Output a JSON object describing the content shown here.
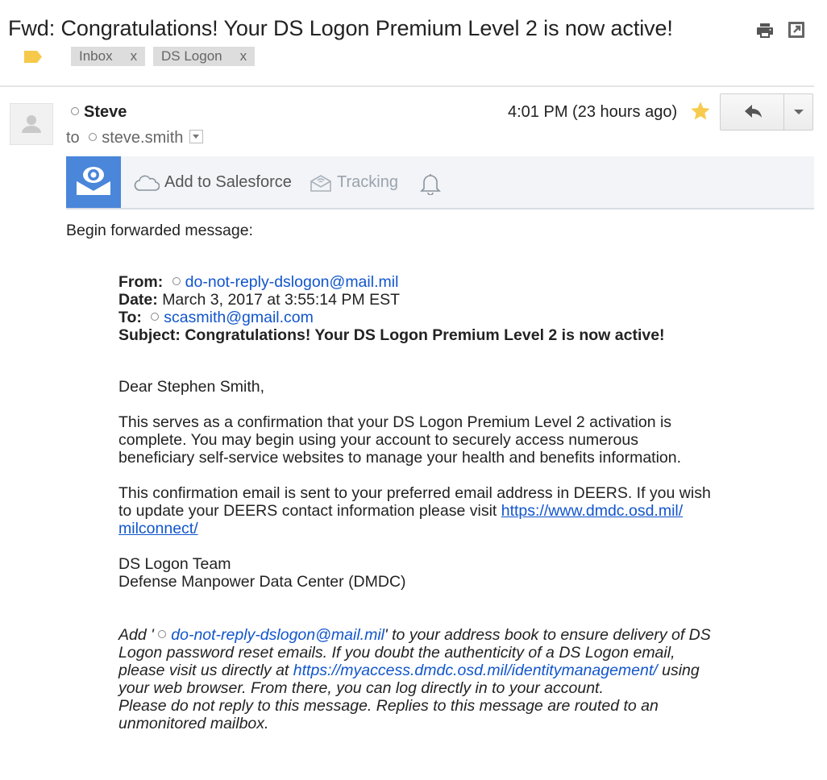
{
  "email": {
    "subject": "Fwd: Congratulations! Your DS Logon Premium Level 2 is now active!",
    "labels": [
      {
        "name": "Inbox",
        "remove": "x"
      },
      {
        "name": "DS Logon",
        "remove": "x"
      }
    ],
    "sender": {
      "name": "Steve"
    },
    "to_prefix": "to",
    "recipient": "steve.smith",
    "time": "4:01 PM (23 hours ago)",
    "starred": true
  },
  "salesforce_bar": {
    "add_label": "Add to Salesforce",
    "tracking_label": "Tracking"
  },
  "body": {
    "intro": "Begin forwarded message:",
    "forward_header": {
      "from_label": "From:",
      "from_value": "do-not-reply-dslogon@mail.mil",
      "date_label": "Date:",
      "date_value": "March 3, 2017 at 3:55:14 PM EST",
      "to_label": "To:",
      "to_value": "scasmith@gmail.com",
      "subject_line": "Subject: Congratulations! Your DS Logon Premium Level 2 is now active!"
    },
    "greeting": "Dear Stephen Smith,",
    "para1": [
      "This serves as a confirmation that your DS Logon Premium Level 2 activation is",
      "complete. You may begin using your account to securely access numerous",
      "beneficiary self-service websites to manage your health and benefits information."
    ],
    "para2_line1": "This confirmation email is sent to your preferred email address in DEERS. If you wish",
    "para2_line2_text": "to update your DEERS contact information please visit ",
    "para2_link_part1": "https://www.dmdc.osd.mil/",
    "para2_link_part2": "milconnect/",
    "signature": [
      "DS Logon Team",
      "Defense Manpower Data Center (DMDC)"
    ],
    "footer": {
      "line1_pre": "Add '",
      "line1_link": "do-not-reply-dslogon@mail.mil",
      "line1_post": "' to your address book to ensure delivery of DS",
      "line2": "Logon password reset emails. If you doubt the authenticity of a DS Logon email,",
      "line3_pre": "please visit us directly at ",
      "line3_link": "https://myaccess.dmdc.osd.mil/identitymanagement/",
      "line3_post": " using",
      "line4": "your web browser. From there, you can log directly in to your account.",
      "line5": "Please do not reply to this message. Replies to this message are routed to an",
      "line6": "unmonitored mailbox."
    }
  },
  "colors": {
    "link": "#1155cc",
    "label_tag": "#f6c94b",
    "star": "#f7cb4d",
    "salesforce_logo_bg": "#4a86d9"
  },
  "icons": [
    "label-icon",
    "print-icon",
    "open-in-new-window-icon",
    "avatar-icon",
    "star-icon",
    "reply-icon",
    "dropdown-icon",
    "salesforce-logo-icon",
    "cloud-icon",
    "tracking-icon",
    "bell-icon"
  ]
}
